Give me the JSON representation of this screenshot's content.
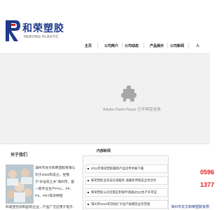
{
  "brand": {
    "name_cn": "和荣塑胶",
    "name_en": "HERONG PLASTIC"
  },
  "nav": {
    "items": [
      "主页",
      "公司简介",
      "公司动态",
      "产品展示",
      "公司新闻",
      "人"
    ]
  },
  "flash": {
    "message": "Adobe Flash Player 已不再受支持",
    "icon": "puzzle-plugin-icon"
  },
  "about": {
    "title": "关于我们",
    "text": "漳州市龙文和荣塑胶有限公司于2000年成立，坐落于\"水仙花之乡\"漳州市，是一家专业生产PVC、PP、PS、PET等多种塑",
    "more": "料吸塑包装制品的企业，产品广泛应用于电子、"
  },
  "news": {
    "title": "内部新闻",
    "items": [
      "2011年和荣塑胶最新产品宣传手册下载",
      "和荣塑胶业务员在线服务 诚邀各界朋友业务合作",
      "和荣塑胶公司近期正积极申请通过QS生产许可证",
      "漳州市2010年持续扩大生产规模及业务范围"
    ]
  },
  "contact": {
    "phone1": "0596",
    "phone2": "1377",
    "company": "漳州市龙文和荣塑胶有限"
  },
  "colors": {
    "brand_blue": "#1e3a8a",
    "phone_red": "#e02020",
    "flash_bg": "#f1f1f1"
  }
}
